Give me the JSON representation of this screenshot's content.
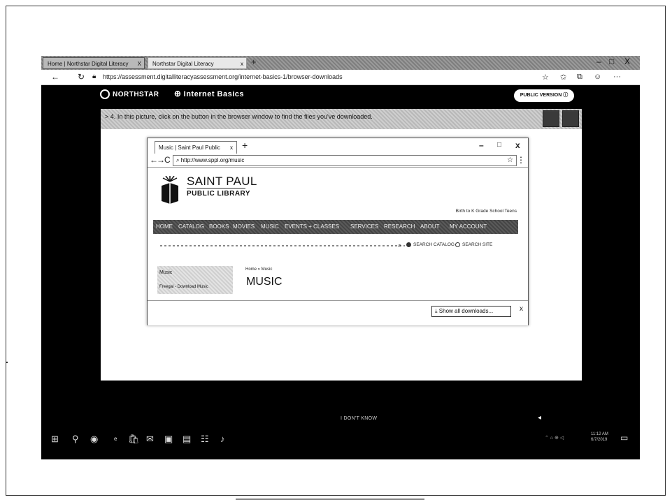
{
  "outer_browser": {
    "tab1_title": "Home | Northstar Digital Literacy",
    "tab1_close": "X",
    "tab2_title": "Northstar Digital Literacy",
    "tab2_close": "x",
    "new_tab": "+",
    "win_min": "–",
    "win_max": "□",
    "win_close": "X",
    "url": "https://assessment.digitalliteracyassessment.org/internet-basics-1/browser-downloads"
  },
  "app_header": {
    "brand": "NORTHSTAR",
    "module": "Internet Basics",
    "public_version": "PUBLIC VERSION"
  },
  "question": {
    "number": "4",
    "text": "In this picture, click on the button in the browser window to find the files you've downloaded."
  },
  "inner_browser": {
    "tab_title": "Music | Saint Paul Public",
    "tab_close": "x",
    "new_tab": "+",
    "win_min": "–",
    "win_max": "□",
    "win_close": "x",
    "url": "http://www.sppl.org/music"
  },
  "library": {
    "name_line1": "SAINT PAUL",
    "name_line2": "PUBLIC LIBRARY",
    "audience_links": "Birth to K   Grade School   Teens",
    "nav": [
      "HOME",
      "CATALOG",
      "BOOKS",
      "MOVIES",
      "MUSIC",
      "EVENTS + CLASSES",
      "SERVICES",
      "RESEARCH",
      "ABOUT",
      "MY ACCOUNT"
    ],
    "search_catalog": "SEARCH CATALOG",
    "search_site": "SEARCH SITE",
    "sidebar_heading": "Music",
    "sidebar_link": "Freegal - Download Music",
    "breadcrumb": "Home » Music",
    "page_heading": "MUSIC"
  },
  "downloads_bar": {
    "show_all": "Show all downloads...",
    "close": "x"
  },
  "footer": {
    "idk": "I DON'T KNOW"
  },
  "taskbar": {
    "time": "11:12 AM",
    "date": "6/7/2019"
  }
}
